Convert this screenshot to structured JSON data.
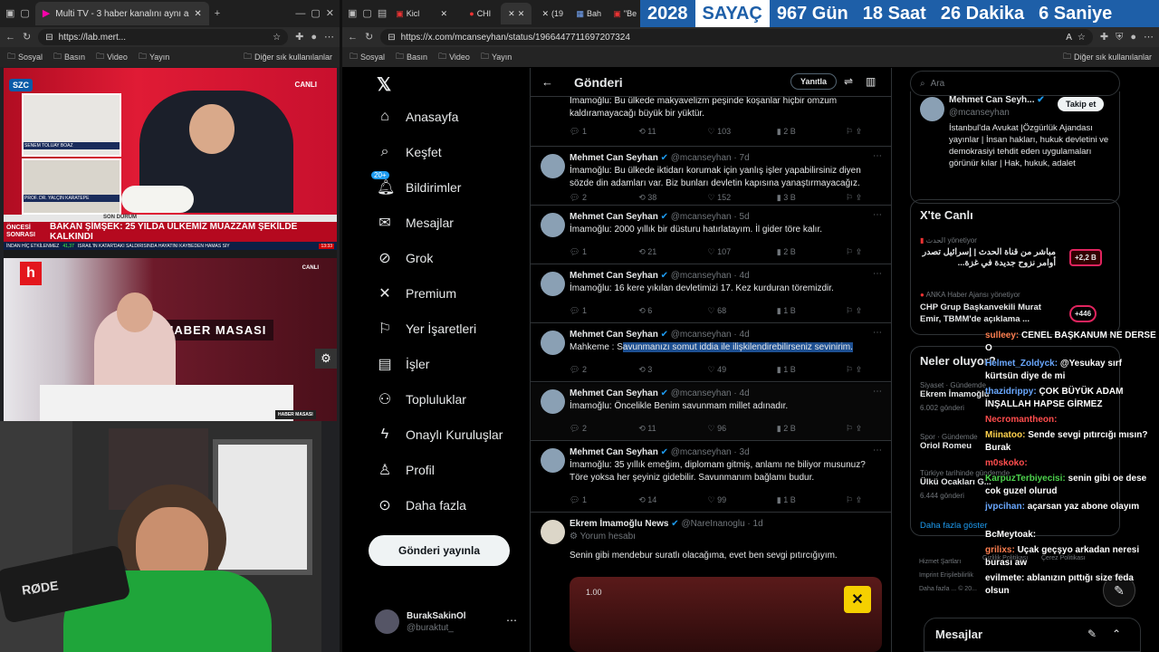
{
  "left_browser": {
    "tab_title": "Multi TV - 3 haber kanalını aynı a",
    "url": "https://lab.mert...",
    "bookmarks": [
      "Sosyal",
      "Basın",
      "Video",
      "Yayın"
    ],
    "other_bookmarks": "Diğer sık kullanılanlar",
    "tv1": {
      "channel_logo": "SZC",
      "live": "CANLI",
      "headline": "BAKAN ŞİMŞEK: 25 YILDA ÜLKEMİZ MUAZZAM ŞEKİLDE KALKINDI",
      "pre_label": "ÖNCESİ SONRASI",
      "guest1": "SENEM TOLUAY BOAZ",
      "guest2": "PROF. DR. YALÇIN KARATEPE",
      "ticker_left": "İNDAN HİÇ ETKİLENMEZ",
      "ticker_right": "İSRAİL'İN KATAR'DAKİ SALDIRISINDA HAYATINI KAYBEDEN HAMAS SİY",
      "ticker_value": "41,37",
      "ticker_time": "13:33",
      "son_durum": "SON DURUM"
    },
    "tv2": {
      "live": "CANLI",
      "banner": "HABER MASASI",
      "logo": "h"
    },
    "cam": {
      "mic_brand": "RØDE"
    }
  },
  "right_browser": {
    "url": "https://x.com/mcanseyhan/status/1966447711697207324",
    "bookmarks": [
      "Sosyal",
      "Basın",
      "Video",
      "Yayın"
    ],
    "other_bookmarks": "Diğer sık kullanılanlar",
    "tabs": [
      "Kicl",
      "CHI",
      "(19",
      "Bah",
      "\"Be",
      "S"
    ],
    "counter": {
      "year": "2028",
      "label": "SAYAÇ",
      "days": "967 Gün",
      "hours": "18 Saat",
      "minutes": "26 Dakika",
      "seconds": "6 Saniye"
    }
  },
  "x_nav": {
    "items": [
      "Anasayfa",
      "Keşfet",
      "Bildirimler",
      "Mesajlar",
      "Grok",
      "Premium",
      "Yer İşaretleri",
      "İşler",
      "Topluluklar",
      "Onaylı Kuruluşlar",
      "Profil",
      "Daha fazla"
    ],
    "notif_badge": "20+",
    "post_button": "Gönderi yayınla",
    "user_name": "BurakSakinOl",
    "user_handle": "@buraktut_"
  },
  "timeline": {
    "title": "Gönderi",
    "reply_button": "Yanıtla",
    "top_text": "İmamoğlu: Bu ülkede makyavelizm peşinde koşanlar hiçbir omzum kaldıramayacağı büyük bir yüktür.",
    "top_stats": {
      "replies": "1",
      "reposts": "11",
      "likes": "103",
      "views": "2 B"
    },
    "tweets": [
      {
        "name": "Mehmet Can Seyhan",
        "handle": "@mcanseyhan · 7d",
        "text": "İmamoğlu: Bu ülkede iktidarı korumak için yanlış işler yapabilirsiniz diyen sözde din adamları var. Biz bunları devletin kapısına yanaştırmayacağız.",
        "replies": "2",
        "reposts": "38",
        "likes": "152",
        "views": "3 B"
      },
      {
        "name": "Mehmet Can Seyhan",
        "handle": "@mcanseyhan · 5d",
        "text": "İmamoğlu: 2000 yıllık bir düsturu hatırlatayım. İl gider töre kalır.",
        "replies": "1",
        "reposts": "21",
        "likes": "107",
        "views": "2 B"
      },
      {
        "name": "Mehmet Can Seyhan",
        "handle": "@mcanseyhan · 4d",
        "text": "İmamoğlu: 16 kere yıkılan devletimizi 17. Kez kurduran töremizdir.",
        "replies": "1",
        "reposts": "6",
        "likes": "68",
        "views": "1 B"
      },
      {
        "name": "Mehmet Can Seyhan",
        "handle": "@mcanseyhan · 4d",
        "text_pre": "Mahkeme : S",
        "text_hl": "avunmanızı somut iddia ile ilişkilendirebilirseniz sevinirim.",
        "replies": "2",
        "reposts": "3",
        "likes": "49",
        "views": "1 B"
      },
      {
        "name": "Mehmet Can Seyhan",
        "handle": "@mcanseyhan · 4d",
        "text": "İmamoğlu: Öncelikle Benim savunmam millet adınadır.",
        "replies": "2",
        "reposts": "11",
        "likes": "96",
        "views": "2 B"
      },
      {
        "name": "Mehmet Can Seyhan",
        "handle": "@mcanseyhan · 3d",
        "text": "İmamoğlu: 35 yıllık emeğim, diplomam gitmiş, anlamı ne biliyor musunuz? Töre yoksa her şeyiniz gidebilir. Savunmanım bağlamı budur.",
        "replies": "1",
        "reposts": "14",
        "likes": "99",
        "views": "1 B"
      },
      {
        "name": "Ekrem İmamoğlu News",
        "handle": "@NareInanoglu · 1d",
        "subtitle": "Yorum hesabı",
        "text": "Senin gibi mendebur suratlı olacağıma, evet ben sevgi pıtırcığıyım.",
        "media_time": "1.00"
      }
    ]
  },
  "sidebar": {
    "search_placeholder": "Ara",
    "profile": {
      "name": "Mehmet Can Seyh...",
      "handle": "@mcanseyhan",
      "follow": "Takip et",
      "bio": "İstanbul'da Avukat |Özgürlük Ajandası yayınlar | İnsan hakları, hukuk devletini ve demokrasiyi tehdit eden uygulamaları görünür kılar | Hak, hukuk, adalet"
    },
    "live_title": "X'te Canlı",
    "live": [
      {
        "source": "الحدث",
        "status": "yönetiyor",
        "text": "مباشر من قناة الحدث | إسرائيل تصدر أوامر نزوح جديدة في غزة...",
        "count": "+2,2 B"
      },
      {
        "source": "ANKA Haber Ajansı",
        "status": "yönetiyor",
        "text": "CHP Grup Başkanvekili Murat Emir, TBMM'de açıklama ...",
        "count": "+446"
      }
    ],
    "trends_title": "Neler oluyor?",
    "trends": [
      {
        "meta": "Siyaset · Gündemde",
        "name": "Ekrem İmamoğlu",
        "count": "6.002 gönderi"
      },
      {
        "meta": "Spor · Gündemde",
        "name": "Oriol Romeu",
        "count": ""
      },
      {
        "meta": "Türkiye tarihinde gündemde",
        "name": "Ülkü Ocakları G...",
        "count": "6.444 gönderi"
      }
    ],
    "show_more": "Daha fazla göster",
    "footer": [
      "Hizmet Şartları",
      "Gizlilik Politikası",
      "Çerez Politikası",
      "Imprint",
      "Erişilebilirlik",
      "Daha fazla ...",
      "© 20..."
    ],
    "messages": "Mesajlar"
  },
  "chat": [
    {
      "user": "sulleey:",
      "msg": "CENEL BAŞKANUM NE DERSE O",
      "color": "#ff7f50"
    },
    {
      "user": "Helmet_Zoldyck:",
      "msg": "@Yesukay sırf kürtsün diye de mi",
      "color": "#6aa8ff"
    },
    {
      "user": "thazidrippy:",
      "msg": "ÇOK BÜYÜK ADAM İNŞALLAH HAPSE GİRMEZ",
      "color": "#6aa8ff"
    },
    {
      "user": "Necromantheon:",
      "msg": "",
      "color": "#ff4d4d"
    },
    {
      "user": "Miinatoo:",
      "msg": "Sende sevgi pıtırcığı mısın? Burak",
      "color": "#ffd24d"
    },
    {
      "user": "m0skoko:",
      "msg": "",
      "color": "#ff4d4d"
    },
    {
      "user": "KarpuzTerbiyecisi:",
      "msg": "senin gibi oe dese cok guzel olurud",
      "color": "#4dd24d"
    },
    {
      "user": "jvpcihan:",
      "msg": "açarsan yaz abone olayım",
      "color": "#6aa8ff"
    },
    {
      "user": "BcMeytoak:",
      "msg": "",
      "color": "#ffffff"
    },
    {
      "user": "grilixs:",
      "msg": "Uçak geçşyo arkadan neresi burası aw",
      "color": "#ff7f50"
    },
    {
      "user": "evilmete:",
      "msg": "ablanızın pıttığı size feda olsun",
      "color": "#ffffff"
    }
  ]
}
